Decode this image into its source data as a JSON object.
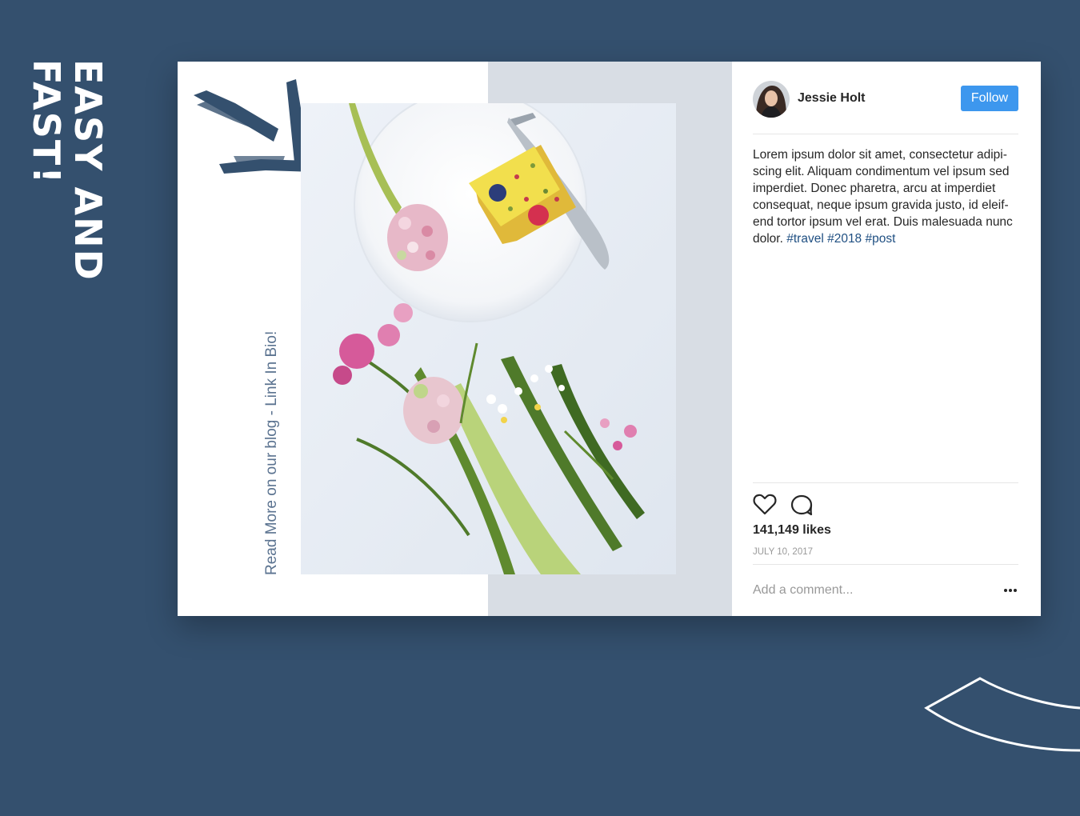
{
  "sidebar": {
    "title": "EASY AND FAST!"
  },
  "media": {
    "caption": "Read More on our blog - Link In Bio!"
  },
  "post": {
    "username": "Jessie Holt",
    "follow_label": "Follow",
    "caption": "Lorem ipsum dolor sit amet, consectetur adipi-scing elit. Aliquam condimentum vel ipsum sed imperdiet. Donec pharetra, arcu at imperdiet consequat, neque ipsum gravida justo, id eleif-end tortor ipsum vel erat. Duis malesuada nunc dolor.",
    "hashtags": [
      "#travel",
      "#2018",
      "#post"
    ],
    "likes": "141,149 likes",
    "date": "JULY 10, 2017",
    "comment_placeholder": "Add a comment..."
  },
  "icons": {
    "like": "heart-icon",
    "comment": "comment-bubble-icon",
    "more": "more-options-icon",
    "arrow": "brush-arrow-icon"
  },
  "colors": {
    "background": "#34506e",
    "follow_button": "#3d97ee",
    "hashtag": "#1f4f82",
    "band": "#d8dde4"
  }
}
